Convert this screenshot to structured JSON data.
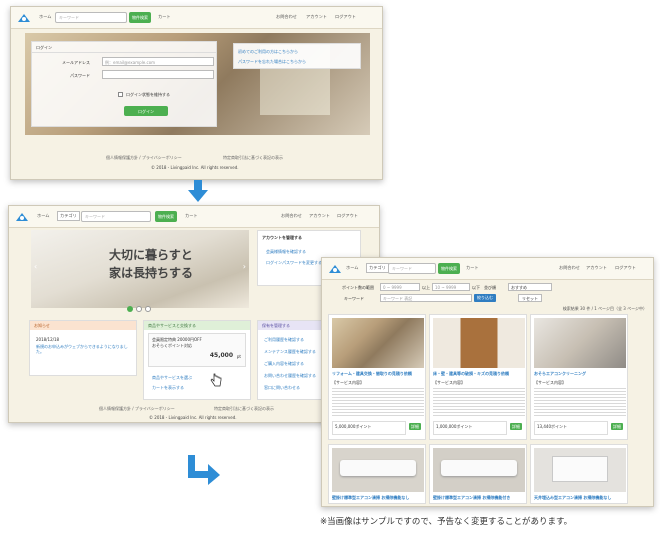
{
  "colors": {
    "accent": "#4caf50",
    "arrow": "#2e8dd6",
    "link": "#2f7dc1",
    "bg": "#f6f2e4"
  },
  "screen1": {
    "nav": {
      "home": "ホーム",
      "search_placeholder": "キーワード",
      "search_button": "物件検索",
      "cart": "カート",
      "contact": "お問合わせ",
      "account": "アカウント",
      "login": "ログアウト"
    },
    "login": {
      "heading": "ログイン",
      "email_label": "メールアドレス",
      "email_placeholder": "例：email@example.com",
      "password_label": "パスワード",
      "remember": "ログイン状態を維持する",
      "submit": "ログイン",
      "link_first": "初めてのご利用の方はこちらから",
      "link_forgot": "パスワードを忘れた場合はこちらから"
    },
    "footer": {
      "links": "個人情報保護方針 / プライバシーポリシー",
      "links2": "特定商取引法に基づく表記の表示",
      "copyright": "© 2018 - Livingpaid Inc. All rights reserved."
    }
  },
  "screen2": {
    "nav": {
      "home": "ホーム",
      "category": "カテゴリ",
      "search_placeholder": "キーワード",
      "search_button": "物件検索",
      "cart": "カート",
      "contact": "お問合わせ",
      "account": "アカウント",
      "login": "ログアウト"
    },
    "hero": {
      "line1": "大切に暮らすと",
      "line2": "家は長持ちする"
    },
    "side": {
      "title": "アカウントを管理する",
      "items": [
        "会員様情報を確認する",
        "ログインパスワードを変更する"
      ]
    },
    "notice": {
      "title": "お知らせ",
      "date": "2018/12/18",
      "text": "新規のお申込みがウェブからできるようになりました。"
    },
    "service": {
      "title": "商品やサービスと交換する",
      "item": "会員限定特典 20000円OFF",
      "item2": "おそらくポイント対応",
      "price": "45,000",
      "unit": "pt",
      "link1": "商品やサービスを選ぶ",
      "link2": "カートを表示する"
    },
    "guide": {
      "title": "保有を管理する",
      "items": [
        "ご利用履歴を確認する",
        "メンテナンス履歴を確認する",
        "ご購入内容を確認する",
        "お問い合わせ履歴を確認する",
        "窓口に問い合わせる"
      ]
    },
    "footer": {
      "links": "個人情報保護方針 / プライバシーポリシー",
      "links2": "特定商取引法に基づく表記の表示",
      "copyright": "© 2018 - Livingpaid Inc. All rights reserved."
    }
  },
  "screen3": {
    "nav": {
      "home": "ホーム",
      "category": "カテゴリ",
      "search_placeholder": "キーワード",
      "search_button": "物件検索",
      "cart": "カート",
      "contact": "お問合わせ",
      "account": "アカウント",
      "login": "ログアウト"
    },
    "filter": {
      "label1": "ポイント数の範囲",
      "label2": "キーワード",
      "from": "0 ~ 9999",
      "to": "10 ~ 9999",
      "mid": "以上",
      "mid2": "以下",
      "sort_label": "並び順",
      "sort": "おすすめ",
      "keyword_placeholder": "キーワード 表記",
      "search_button": "絞り込む",
      "reset": "リセット"
    },
    "result": "検索結果 30 件 / 1 ページ目（全 3 ページ中）",
    "items": [
      {
        "title": "リフォーム・建具交換・間取りの見積り依頼",
        "sub": "【サービス内容】",
        "pts": "5,000,000ポイント",
        "button": "詳細"
      },
      {
        "title": "床・壁・建具等の破損・キズの見積り依頼",
        "sub": "【サービス内容】",
        "pts": "1,000,000ポイント",
        "button": "詳細"
      },
      {
        "title": "おそらエアコンクリーニング",
        "sub": "【サービス内容】",
        "pts": "13,440ポイント",
        "button": "詳細"
      }
    ],
    "items2": [
      {
        "title": "壁掛け標準型エアコン清掃 お掃除機能なし"
      },
      {
        "title": "壁掛け標準型エアコン清掃 お掃除機能付き"
      },
      {
        "title": "天井埋込み型エアコン清掃 お掃除機能なし"
      }
    ]
  },
  "notice": "※当画像はサンプルですので、予告なく変更することがあります。"
}
